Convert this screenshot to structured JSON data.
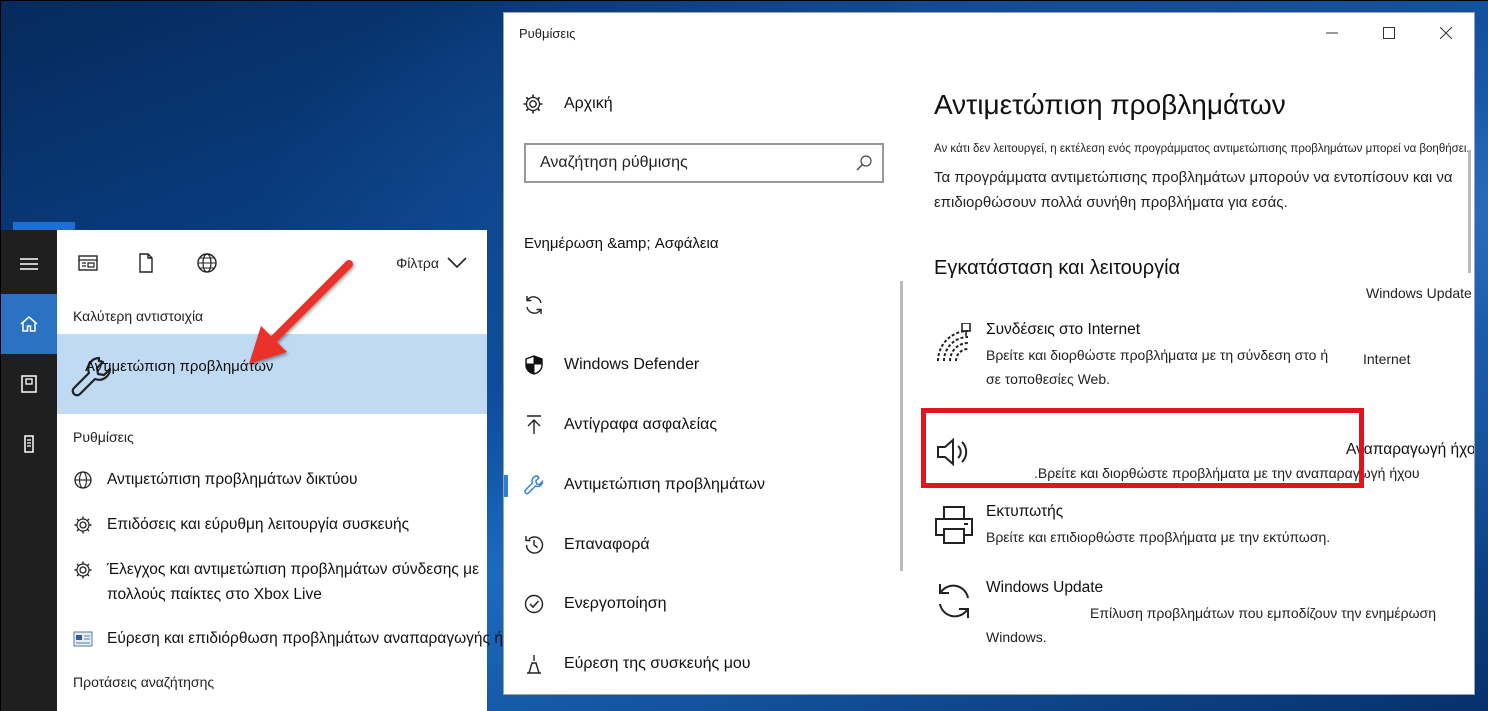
{
  "start_panel": {
    "filter_label": "Φίλτρα",
    "best_match_heading": "Καλύτερη αντιστοιχία",
    "best_match_label": "Αντιμετώπιση προβλημάτων",
    "settings_heading": "Ρυθμίσεις",
    "results": [
      {
        "label": "Αντιμετώπιση προβλημάτων δικτύου",
        "icon": "globe-icon"
      },
      {
        "label": "Επιδόσεις και εύρυθμη λειτουργία συσκευής",
        "icon": "gear-icon"
      },
      {
        "label": "Έλεγχος και αντιμετώπιση προβλημάτων σύνδεσης με πολλούς παίκτες στο Xbox Live",
        "icon": "gear-icon"
      },
      {
        "label": "Εύρεση και επιδιόρθωση προβλημάτων αναπαραγωγής ήχου",
        "icon": "control-panel-icon"
      }
    ],
    "suggestions_heading": "Προτάσεις αναζήτησης"
  },
  "window": {
    "title": "Ρυθμίσεις"
  },
  "nav": {
    "home_label": "Αρχική",
    "search_placeholder": "Αναζήτηση ρύθμισης",
    "section_heading": "Ενημέρωση &amp; Ασφάλεια",
    "items": [
      {
        "label": "",
        "icon": "sync-icon"
      },
      {
        "label": "Windows Defender",
        "icon": "shield-icon"
      },
      {
        "label": "Αντίγραφα ασφαλείας",
        "icon": "upload-arrow-icon"
      },
      {
        "label": "Αντιμετώπιση προβλημάτων",
        "icon": "wrench-icon",
        "selected": true
      },
      {
        "label": "Επαναφορά",
        "icon": "history-icon"
      },
      {
        "label": "Ενεργοποίηση",
        "icon": "check-circle-icon"
      },
      {
        "label": "Εύρεση της συσκευής μου",
        "icon": "location-icon"
      }
    ]
  },
  "content": {
    "title": "Αντιμετώπιση προβλημάτων",
    "small_text": "Αν κάτι δεν λειτουργεί, η εκτέλεση ενός προγράμματος αντιμετώπισης προβλημάτων μπορεί να βοηθήσει.",
    "description": "Τα προγράμματα αντιμετώπισης προβλημάτων μπορούν να εντοπίσουν και να επιδιορθώσουν πολλά συνήθη προβλήματα για εσάς.",
    "section_heading": "Εγκατάσταση και λειτουργία",
    "windows_update_top": "Windows Update",
    "internet": {
      "title": "Συνδέσεις στο Internet",
      "desc_line1": "Βρείτε και διορθώστε προβλήματα με τη σύνδεση στο ή",
      "desc_line1_end": "Internet",
      "desc_line2": "σε τοποθεσίες Web."
    },
    "audio": {
      "title": "Αναπαραγωγή ήχου",
      "desc": ".Βρείτε και διορθώστε προβλήματα με την αναπαραγωγή ήχου"
    },
    "printer": {
      "title": "Εκτυπωτής",
      "desc": "Βρείτε και επιδιορθώστε προβλήματα με την εκτύπωση."
    },
    "windows_update": {
      "title": "Windows Update",
      "desc_line1": "Επίλυση προβλημάτων που εμποδίζουν την ενημέρωση",
      "desc_line2": "Windows."
    }
  },
  "colors": {
    "accent": "#2b73c2",
    "selection": "#bfdaf2",
    "highlight_box": "#e0141b",
    "annotation_arrow": "#e8312a"
  }
}
